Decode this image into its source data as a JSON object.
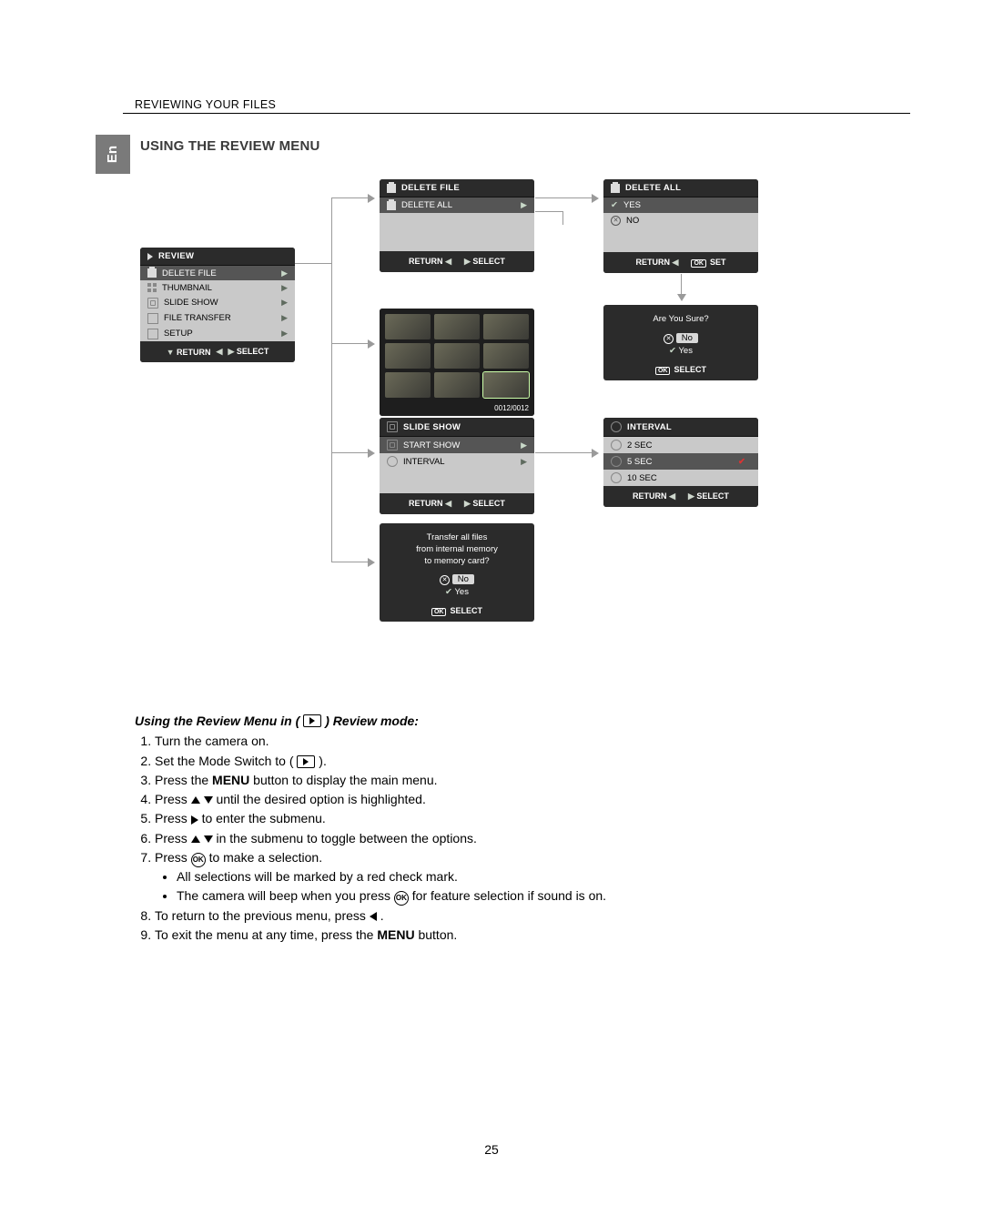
{
  "breadcrumb": "REVIEWING YOUR FILES",
  "language_tab": "En",
  "section_title": "USING THE REVIEW MENU",
  "page_number": "25",
  "review_menu": {
    "title": "REVIEW",
    "item_delete_file": "DELETE FILE",
    "item_thumbnail": "THUMBNAIL",
    "item_slide_show": "SLIDE SHOW",
    "item_file_transfer": "FILE TRANSFER",
    "item_setup": "SETUP",
    "footer_return": "RETURN",
    "footer_select": "SELECT"
  },
  "delete_file_menu": {
    "title": "DELETE FILE",
    "item_delete_all": "DELETE ALL",
    "footer_return": "RETURN",
    "footer_select": "SELECT"
  },
  "delete_all_menu": {
    "title": "DELETE ALL",
    "item_yes": "YES",
    "item_no": "NO",
    "footer_return": "RETURN",
    "footer_set": "SET"
  },
  "confirm_delete": {
    "question": "Are You Sure?",
    "no_label": "No",
    "yes_label": "Yes",
    "footer_select": "SELECT"
  },
  "thumbnail": {
    "counter": "0012/0012"
  },
  "slide_show_menu": {
    "title": "SLIDE SHOW",
    "item_start_show": "START SHOW",
    "item_interval": "INTERVAL",
    "footer_return": "RETURN",
    "footer_select": "SELECT"
  },
  "interval_menu": {
    "title": "INTERVAL",
    "opt_2": "2  SEC",
    "opt_5": "5  SEC",
    "opt_10": "10 SEC",
    "footer_return": "RETURN",
    "footer_select": "SELECT"
  },
  "transfer_confirm": {
    "line1": "Transfer all files",
    "line2": "from internal memory",
    "line3": "to memory card?",
    "no_label": "No",
    "yes_label": "Yes",
    "footer_select": "SELECT"
  },
  "instructions": {
    "lead_part1": "Using the Review Menu in  (",
    "lead_part2": ") Review mode:",
    "s1": "Turn the camera on.",
    "s2a": "Set the Mode Switch to ( ",
    "s2b": " ).",
    "s3a": "Press the ",
    "s3_menu": "MENU",
    "s3b": " button to display the main menu.",
    "s4a": "Press ",
    "s4b": " until the desired option is highlighted.",
    "s5a": "Press ",
    "s5b": " to enter the submenu.",
    "s6a": "Press ",
    "s6b": " in the submenu to toggle between the options.",
    "s7a": "Press ",
    "s7b": " to make a selection.",
    "s7_bullet1": "All selections will be marked by a red check mark.",
    "s7_bullet2a": "The camera will beep when you press ",
    "s7_bullet2b": " for feature selection if sound is on.",
    "s8a": "To return to the previous menu, press ",
    "s8b": " .",
    "s9a": "To exit the menu at any time, press the ",
    "s9_menu": "MENU",
    "s9b": " button."
  }
}
